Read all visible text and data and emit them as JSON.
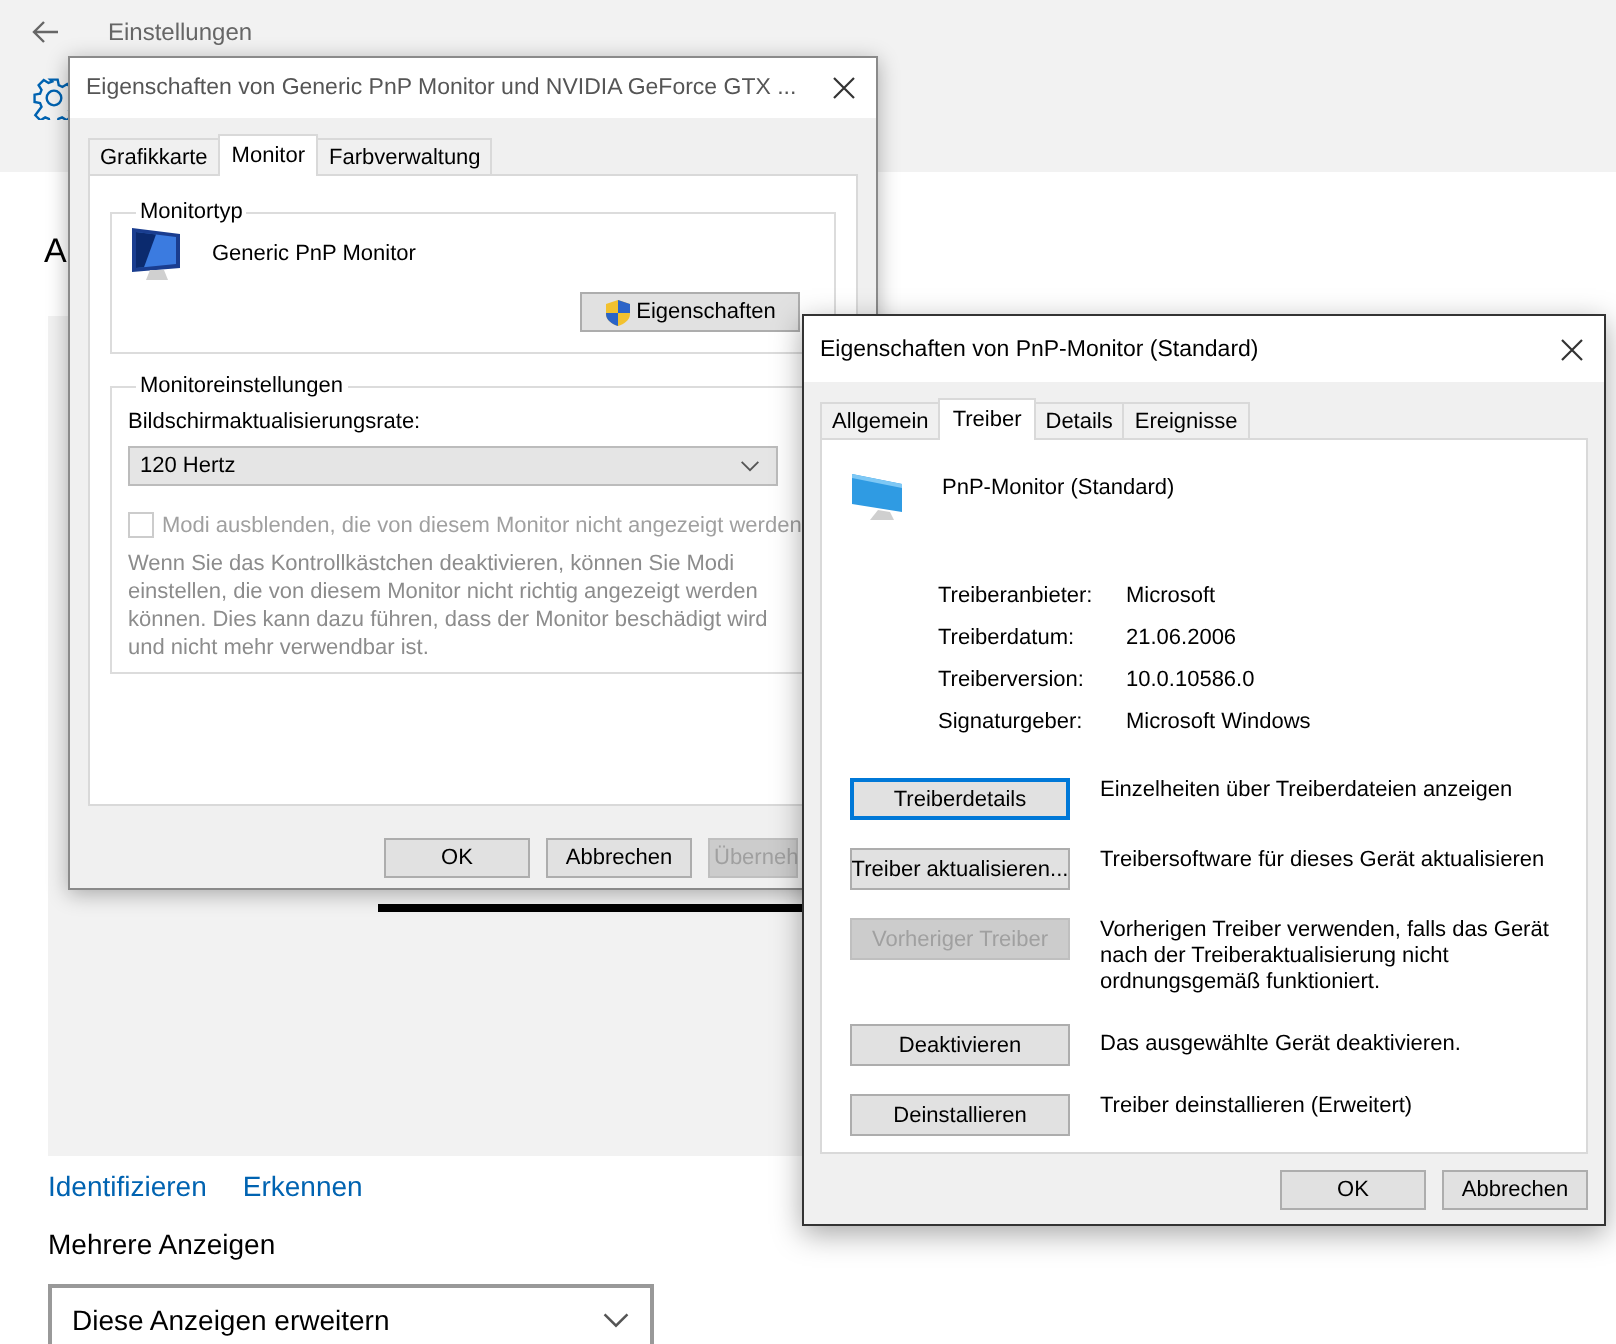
{
  "settings": {
    "title": "Einstellungen",
    "heading": "A",
    "links": [
      "Identifizieren",
      "Erkennen"
    ],
    "multi_label": "Mehrere Anzeigen",
    "multi_dropdown": {
      "value": "Diese Anzeigen erweitern"
    }
  },
  "dialog1": {
    "title": "Eigenschaften von Generic PnP Monitor und NVIDIA GeForce GTX ...",
    "tabs": [
      {
        "label": "Grafikkarte",
        "selected": false
      },
      {
        "label": "Monitor",
        "selected": true
      },
      {
        "label": "Farbverwaltung",
        "selected": false
      }
    ],
    "monitor_type": {
      "group_label": "Monitortyp",
      "name": "Generic PnP Monitor",
      "button": "Eigenschaften"
    },
    "settings_group": {
      "group_label": "Monitoreinstellungen",
      "rate_label": "Bildschirmaktualisierungsrate:",
      "rate_value": "120 Hertz",
      "checkbox": {
        "label": "Modi ausblenden, die von diesem Monitor nicht angezeigt werden",
        "checked": false,
        "disabled": true
      },
      "description": "Wenn Sie das Kontrollkästchen deaktivieren, können Sie Modi einstellen, die von diesem Monitor nicht richtig angezeigt werden können. Dies kann dazu führen, dass der Monitor beschädigt wird und nicht mehr verwendbar ist."
    },
    "buttons": [
      {
        "label": "OK",
        "disabled": false
      },
      {
        "label": "Abbrechen",
        "disabled": false
      },
      {
        "label": "Überneh",
        "disabled": true
      }
    ]
  },
  "dialog2": {
    "title": "Eigenschaften von PnP-Monitor (Standard)",
    "tabs": [
      {
        "label": "Allgemein",
        "selected": false
      },
      {
        "label": "Treiber",
        "selected": true
      },
      {
        "label": "Details",
        "selected": false
      },
      {
        "label": "Ereignisse",
        "selected": false
      }
    ],
    "device_name": "PnP-Monitor (Standard)",
    "info": [
      {
        "label": "Treiberanbieter:",
        "value": "Microsoft"
      },
      {
        "label": "Treiberdatum:",
        "value": "21.06.2006"
      },
      {
        "label": "Treiberversion:",
        "value": "10.0.10586.0"
      },
      {
        "label": "Signaturgeber:",
        "value": "Microsoft Windows"
      }
    ],
    "actions": [
      {
        "button": "Treiberdetails",
        "description": "Einzelheiten über Treiberdateien anzeigen",
        "disabled": false,
        "focused": true
      },
      {
        "button": "Treiber aktualisieren...",
        "description": "Treibersoftware für dieses Gerät aktualisieren",
        "disabled": false,
        "focused": false
      },
      {
        "button": "Vorheriger Treiber",
        "description": "Vorherigen Treiber verwenden, falls das Gerät nach der Treiberaktualisierung nicht ordnungsgemäß funktioniert.",
        "disabled": true,
        "focused": false
      },
      {
        "button": "Deaktivieren",
        "description": "Das ausgewählte Gerät deaktivieren.",
        "disabled": false,
        "focused": false
      },
      {
        "button": "Deinstallieren",
        "description": "Treiber deinstallieren (Erweitert)",
        "disabled": false,
        "focused": false
      }
    ],
    "buttons": [
      {
        "label": "OK",
        "disabled": false
      },
      {
        "label": "Abbrechen",
        "disabled": false
      }
    ]
  }
}
